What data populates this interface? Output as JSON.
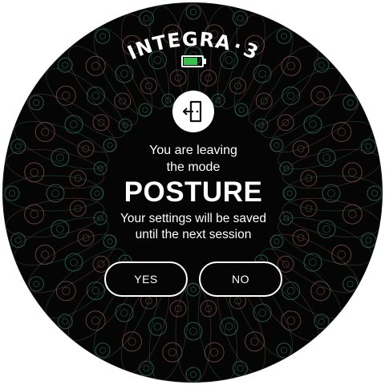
{
  "device": {
    "brand": "INTEGRA",
    "brand_separator": "·",
    "brand_number": "3"
  },
  "battery": {
    "level": 0.85,
    "color": "#36c24a"
  },
  "dialog": {
    "icon": "exit-door-icon",
    "message_line_1": "You are leaving",
    "message_line_2": "the mode",
    "mode_name": "POSTURE",
    "note_line_1": "Your settings will be saved",
    "note_line_2": "until the next session"
  },
  "buttons": {
    "yes_label": "YES",
    "no_label": "NO"
  },
  "colors": {
    "background": "#050505",
    "text": "#ffffff",
    "pattern_green": "#2f6b5a",
    "pattern_rose": "#7a4c4c"
  }
}
